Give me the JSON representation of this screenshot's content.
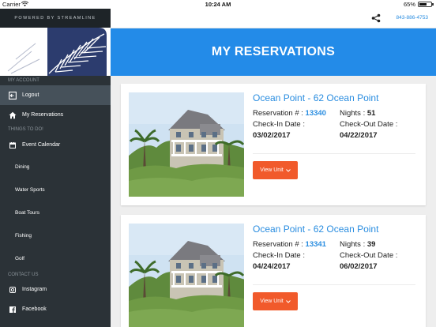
{
  "status_bar": {
    "carrier": "Carrier",
    "time": "10:24 AM",
    "battery": "65%",
    "battery_level": 0.65
  },
  "sidebar": {
    "powered_by": "POWERED BY STREAMLINE",
    "sections": {
      "my_account": "MY ACCOUNT",
      "things_to_do": "THINGS TO DO!",
      "contact_us": "CONTACT US"
    },
    "account_items": [
      {
        "label": "Logout",
        "icon": "logout-icon",
        "active": true
      },
      {
        "label": "My Reservations",
        "icon": "home-icon",
        "active": false
      }
    ],
    "todo_items": [
      {
        "label": "Event Calendar",
        "icon": "calendar-icon"
      },
      {
        "label": "Dining"
      },
      {
        "label": "Water Sports"
      },
      {
        "label": "Boat Tours"
      },
      {
        "label": "Fishing"
      },
      {
        "label": "Golf"
      }
    ],
    "contact_items": [
      {
        "label": "Instagram",
        "icon": "instagram-icon"
      },
      {
        "label": "Facebook",
        "icon": "facebook-icon"
      }
    ]
  },
  "topnav": {
    "share_icon": "share-icon",
    "phone": "843-886-4753"
  },
  "banner": {
    "title": "MY RESERVATIONS"
  },
  "reservations": [
    {
      "title": "Ocean Point - 62 Ocean Point",
      "reservation_label": "Reservation # :",
      "reservation_number": "13340",
      "nights_label": "Nights :",
      "nights": "51",
      "checkin_label": "Check-In Date :",
      "checkin": "03/02/2017",
      "checkout_label": "Check-Out Date :",
      "checkout": "04/22/2017",
      "button": "View Unit"
    },
    {
      "title": "Ocean Point - 62 Ocean Point",
      "reservation_label": "Reservation # :",
      "reservation_number": "13341",
      "nights_label": "Nights :",
      "nights": "39",
      "checkin_label": "Check-In Date :",
      "checkin": "04/24/2017",
      "checkout_label": "Check-Out Date :",
      "checkout": "06/02/2017",
      "button": "View Unit"
    }
  ],
  "colors": {
    "accent": "#238be8",
    "button": "#f15a2b",
    "sidebar": "#2b3237",
    "link": "#2a8de0"
  }
}
